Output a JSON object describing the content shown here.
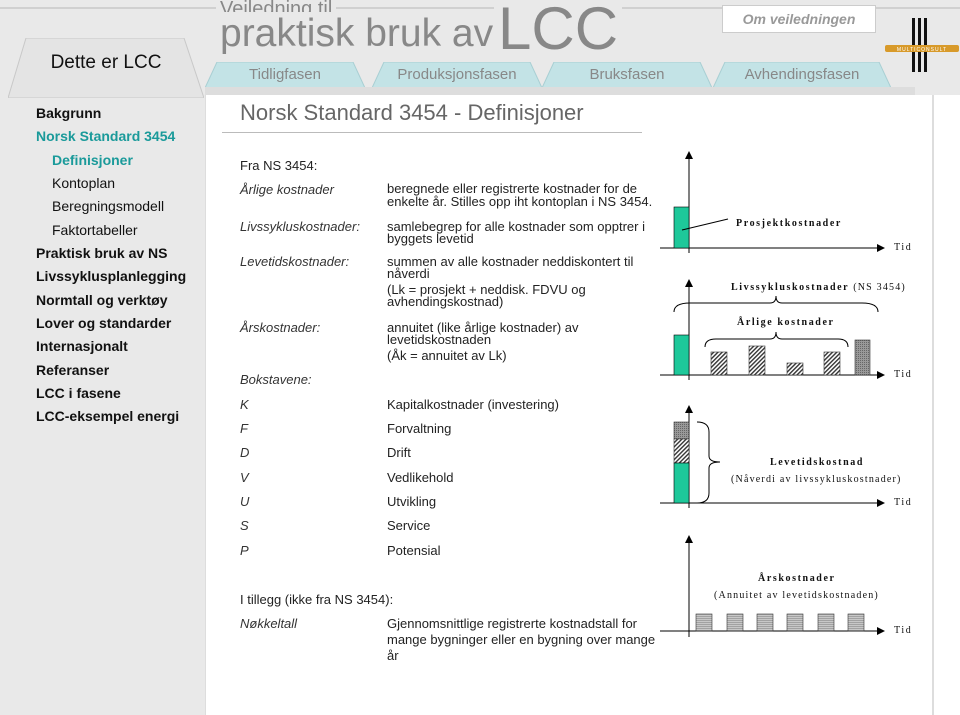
{
  "header": {
    "subtitle": "Veiledning til",
    "title": "praktisk bruk av",
    "title_big": "LCC",
    "about_link": "Om veiledningen",
    "logo_text": "MULTICONSULT",
    "colors": {
      "accent": "#1a9a9a",
      "tab": "#c3e3e6"
    }
  },
  "main_tab": "Dette er LCC",
  "phase_tabs": [
    "Tidligfasen",
    "Produksjonsfasen",
    "Bruksfasen",
    "Avhendingsfasen"
  ],
  "sidebar": {
    "items": [
      {
        "label": "Bakgrunn",
        "level": 1
      },
      {
        "label": "Norsk Standard 3454",
        "level": 1,
        "active": true
      },
      {
        "label": "Definisjoner",
        "level": 2,
        "active": true
      },
      {
        "label": "Kontoplan",
        "level": 2
      },
      {
        "label": "Beregningsmodell",
        "level": 2
      },
      {
        "label": "Faktortabeller",
        "level": 2
      },
      {
        "label": "Praktisk bruk av NS",
        "level": 1
      },
      {
        "label": "Livssyklusplanlegging",
        "level": 1
      },
      {
        "label": "Normtall og verktøy",
        "level": 1
      },
      {
        "label": "Lover og standarder",
        "level": 1
      },
      {
        "label": "Internasjonalt",
        "level": 1
      },
      {
        "label": "Referanser",
        "level": 1
      },
      {
        "label": "LCC i fasene",
        "level": 1
      },
      {
        "label": "LCC-eksempel energi",
        "level": 1
      }
    ]
  },
  "page_title": "Norsk Standard 3454 - Definisjoner",
  "content": {
    "intro": "Fra NS 3454:",
    "definitions": [
      {
        "term": "Årlige kostnader",
        "lines": [
          "beregnede eller registrerte kostnader for de",
          "enkelte år. Stilles opp iht kontoplan i NS 3454."
        ]
      },
      {
        "term": "Livssykluskostnader:",
        "lines": [
          "samlebegrep for alle kostnader som opptrer i",
          "byggets levetid"
        ]
      },
      {
        "term": "Levetidskostnader:",
        "lines": [
          "summen av alle kostnader neddiskontert til",
          "nåverdi"
        ],
        "extra": [
          "(Lk = prosjekt + neddisk. FDVU og",
          "avhendingskostnad)"
        ]
      },
      {
        "term": "Årskostnader:",
        "lines": [
          "annuitet (like årlige kostnader) av",
          "levetidskostnaden"
        ],
        "extra": [
          "(Åk = annuitet av Lk)"
        ]
      }
    ],
    "letters_heading": "Bokstavene:",
    "letters": [
      {
        "letter": "K",
        "meaning": "Kapitalkostnader (investering)"
      },
      {
        "letter": "F",
        "meaning": "Forvaltning"
      },
      {
        "letter": "D",
        "meaning": "Drift"
      },
      {
        "letter": "V",
        "meaning": "Vedlikehold"
      },
      {
        "letter": "U",
        "meaning": "Utvikling"
      },
      {
        "letter": "S",
        "meaning": "Service"
      },
      {
        "letter": "P",
        "meaning": "Potensial"
      }
    ],
    "addition_heading": "I tillegg (ikke fra NS 3454):",
    "addition": {
      "term": "Nøkkeltall",
      "lines": [
        "Gjennomsnittlige registrerte kostnadstall for",
        "mange bygninger eller en bygning over mange",
        "år"
      ]
    }
  },
  "diagram": {
    "axis_label": "Tid",
    "panel1": {
      "label": "Prosjektkostnader"
    },
    "panel2": {
      "label_bold": "Livssykluskostnader",
      "label_normal": "(NS 3454)",
      "annual_label": "Årlige kostnader"
    },
    "panel3": {
      "label": "Levetidskostnad",
      "sublabel": "(Nåverdi av livssykluskostnader)"
    },
    "panel4": {
      "label": "Årskostnader",
      "sublabel": "(Annuitet av levetidskostnaden)"
    },
    "colors": {
      "project": "#1ec89a",
      "grid": "#999999",
      "annual": "#bbbbbb"
    }
  }
}
